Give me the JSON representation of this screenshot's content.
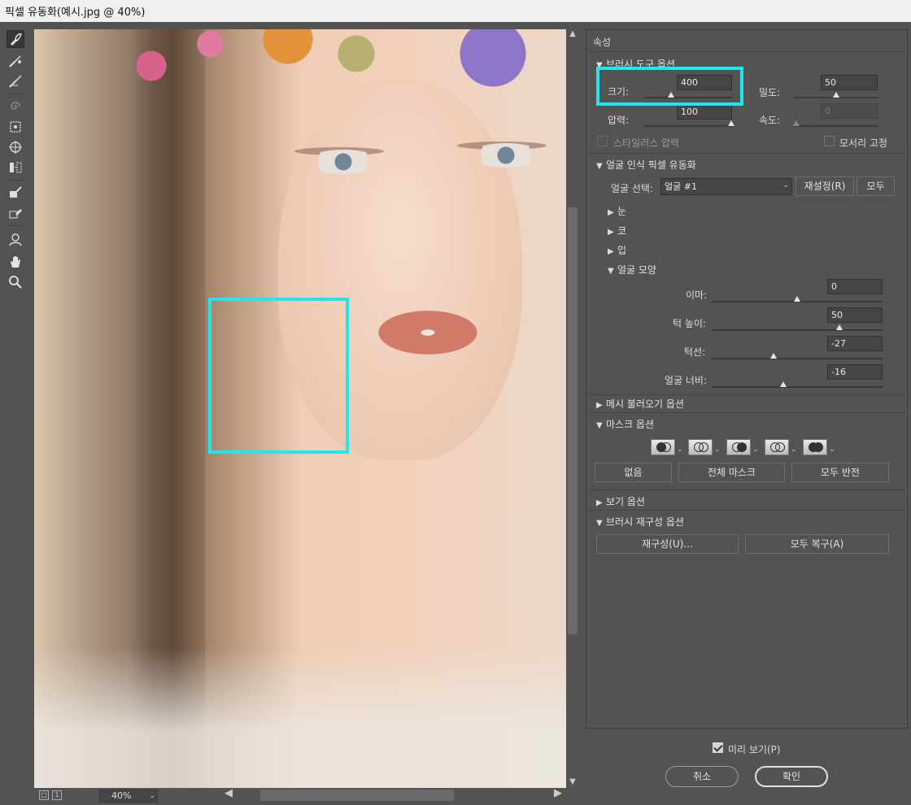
{
  "window": {
    "title": "픽셀 유동화(예시.jpg @ 40%)"
  },
  "toolbar": {
    "tools": [
      {
        "name": "forward-warp-tool"
      },
      {
        "name": "reconstruct-tool"
      },
      {
        "name": "smooth-tool"
      },
      {
        "name": "twirl-clockwise-tool"
      },
      {
        "name": "pucker-tool"
      },
      {
        "name": "bloat-tool"
      },
      {
        "name": "push-left-tool"
      },
      {
        "name": "freeze-mask-tool"
      },
      {
        "name": "thaw-mask-tool"
      },
      {
        "name": "face-tool"
      },
      {
        "name": "hand-tool"
      },
      {
        "name": "zoom-tool"
      }
    ]
  },
  "statusbar": {
    "zoom": "40%"
  },
  "panel": {
    "title": "속성",
    "brush_tool_options": {
      "heading": "브러시 도구 옵션",
      "size_label": "크기:",
      "size_value": "400",
      "density_label": "밀도:",
      "density_value": "50",
      "pressure_label": "압력:",
      "pressure_value": "100",
      "rate_label": "속도:",
      "rate_value": "0",
      "stylus_label": "스타일러스 압력",
      "pin_edges_label": "모서리 고정"
    },
    "face_aware": {
      "heading": "얼굴 인식 픽셀 유동화",
      "select_face_label": "얼굴 선택:",
      "select_face_value": "얼굴 #1",
      "reset_button": "재설정(R)",
      "all_button": "모두",
      "groups": [
        "눈",
        "코",
        "입"
      ],
      "face_shape_heading": "얼굴 모양",
      "forehead_label": "이마:",
      "forehead_value": "0",
      "chin_height_label": "턱 높이:",
      "chin_height_value": "50",
      "jawline_label": "턱선:",
      "jawline_value": "-27",
      "face_width_label": "얼굴 너비:",
      "face_width_value": "-16"
    },
    "load_mesh": {
      "heading": "메시 불러오기 옵션"
    },
    "mask_options": {
      "heading": "마스크 옵션",
      "none_button": "없음",
      "mask_all_button": "전체 마스크",
      "invert_all_button": "모두 반전"
    },
    "view_options": {
      "heading": "보기 옵션"
    },
    "brush_reconstruct": {
      "heading": "브러시 재구성 옵션",
      "reconstruct_button": "재구성(U)...",
      "restore_all_button": "모두 복구(A)"
    }
  },
  "footer": {
    "preview_label": "미리 보기(P)",
    "preview_checked": true,
    "cancel_button": "취소",
    "ok_button": "확인"
  },
  "colors": {
    "highlight": "#1ee8ee",
    "panel_bg": "#535353"
  }
}
